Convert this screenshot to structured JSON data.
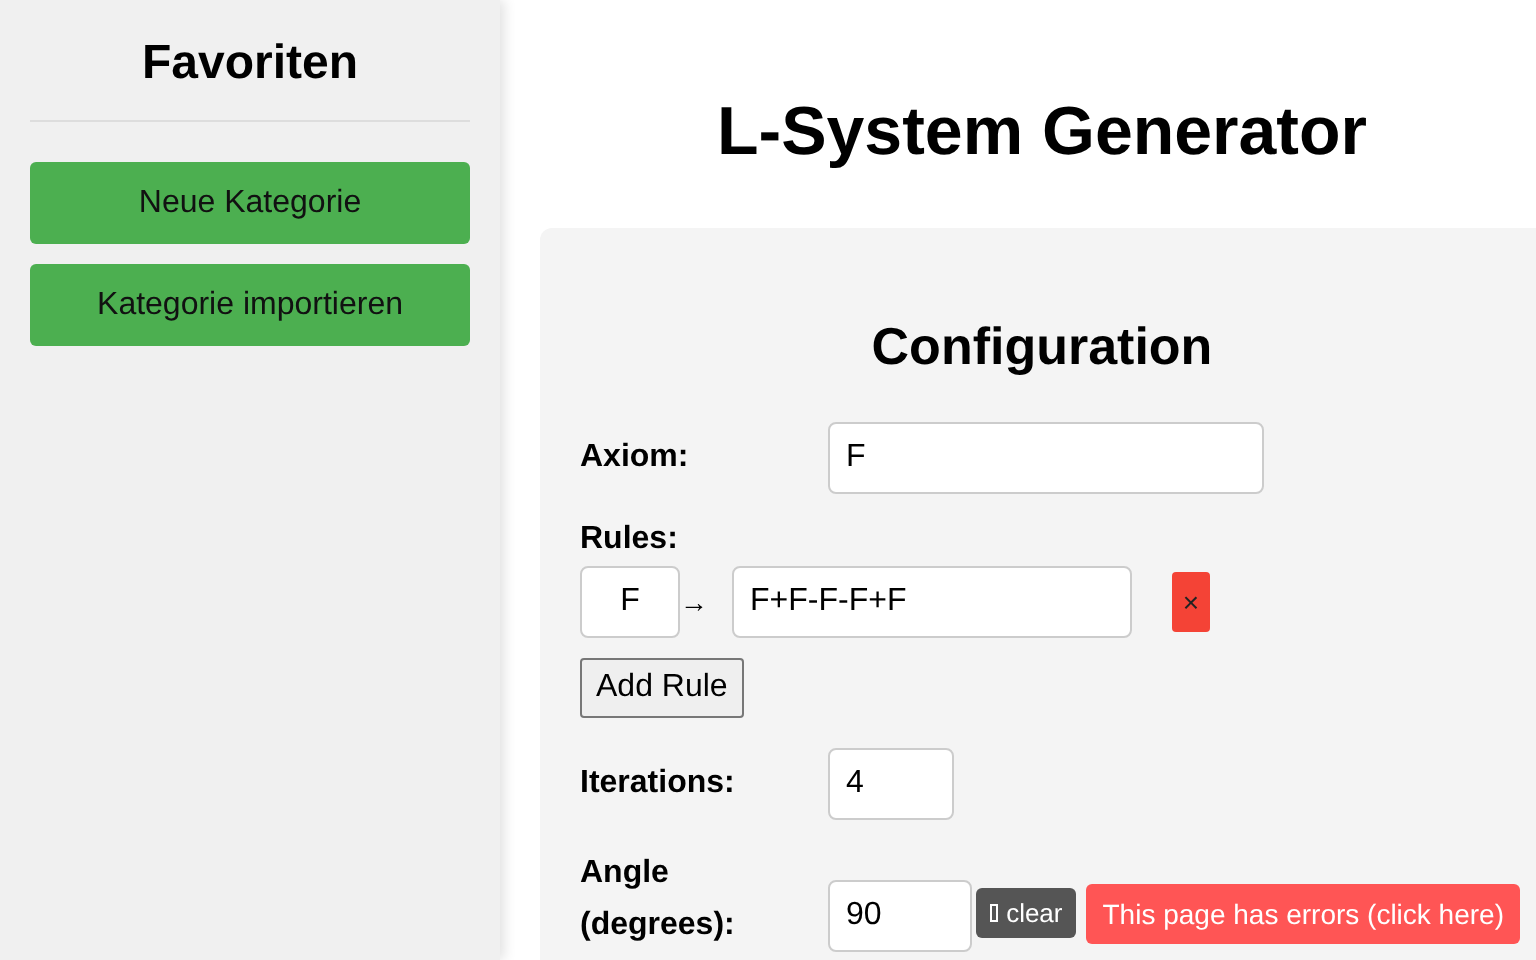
{
  "sidebar": {
    "title": "Favoriten",
    "buttons": [
      "Neue Kategorie",
      "Kategorie importieren"
    ]
  },
  "page_title": "L-System Generator",
  "config": {
    "title": "Configuration",
    "axiom": {
      "label": "Axiom:",
      "value": "F"
    },
    "rules": {
      "label": "Rules:",
      "items": [
        {
          "symbol": "F",
          "arrow": "→",
          "replacement": "F+F-F-F+F",
          "delete": "×"
        }
      ],
      "add_button": "Add Rule"
    },
    "iterations": {
      "label": "Iterations:",
      "value": "4"
    },
    "angle": {
      "label": "Angle (degrees):",
      "value": "90"
    }
  },
  "error_bar": {
    "clear_button": "clear",
    "error_button": "This page has errors (click here)"
  }
}
